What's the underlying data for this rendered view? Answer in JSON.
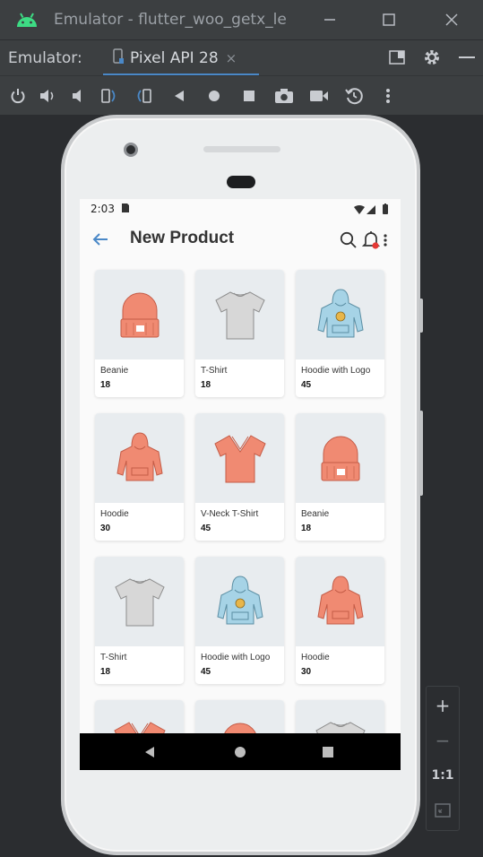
{
  "window": {
    "title": "Emulator - flutter_woo_getx_le",
    "icon": "android-icon",
    "controls": [
      "minimize-icon",
      "maximize-icon",
      "close-icon"
    ]
  },
  "tabbar": {
    "label": "Emulator:",
    "tab_label": "Pixel API 28",
    "tab_close": "×"
  },
  "toolbar": {
    "icons": [
      "power-icon",
      "volume-up-icon",
      "volume-down-icon",
      "rotate-left-icon",
      "rotate-right-icon",
      "back-icon",
      "home-icon",
      "overview-icon",
      "screenshot-icon",
      "screen-record-icon",
      "snapshot-icon",
      "more-icon"
    ]
  },
  "device": {
    "status": {
      "time": "2:03"
    },
    "appbar": {
      "title": "New Product"
    },
    "products": [
      {
        "name": "Beanie",
        "price": "18",
        "kind": "beanie"
      },
      {
        "name": "T-Shirt",
        "price": "18",
        "kind": "tshirt"
      },
      {
        "name": "Hoodie with Logo",
        "price": "45",
        "kind": "hoodie-logo"
      },
      {
        "name": "Hoodie",
        "price": "30",
        "kind": "hoodie"
      },
      {
        "name": "V-Neck T-Shirt",
        "price": "45",
        "kind": "vneck"
      },
      {
        "name": "Beanie",
        "price": "18",
        "kind": "beanie"
      },
      {
        "name": "T-Shirt",
        "price": "18",
        "kind": "tshirt"
      },
      {
        "name": "Hoodie with Logo",
        "price": "45",
        "kind": "hoodie-logo"
      },
      {
        "name": "Hoodie",
        "price": "30",
        "kind": "hoodie"
      },
      {
        "name": "",
        "price": "",
        "kind": "vneck"
      },
      {
        "name": "",
        "price": "",
        "kind": "beanie"
      },
      {
        "name": "",
        "price": "",
        "kind": "tshirt"
      }
    ]
  },
  "zoom": {
    "plus": "+",
    "minus": "−",
    "one_to_one": "1:1"
  },
  "colors": {
    "accent": "#4a88c7",
    "product_salmon": "#f08a72",
    "product_blue": "#a6d3e6",
    "product_grey": "#d7d7d7"
  }
}
